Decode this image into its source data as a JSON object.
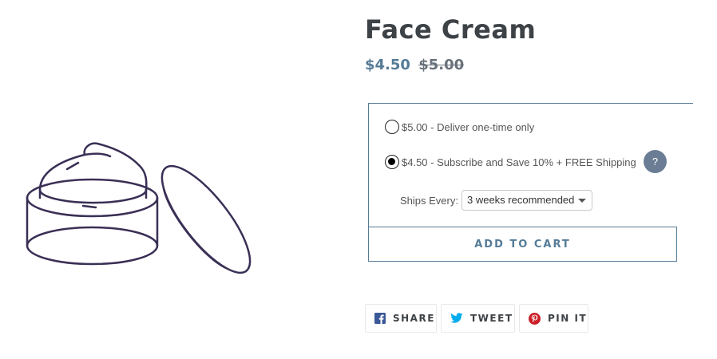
{
  "product": {
    "title": "Face Cream",
    "price_sale": "$4.50",
    "price_compare": "$5.00"
  },
  "purchase_options": [
    {
      "label": "$5.00 - Deliver one-time only",
      "selected": false
    },
    {
      "label": "$4.50 - Subscribe and Save 10% + FREE Shipping",
      "selected": true
    }
  ],
  "help": {
    "symbol": "?"
  },
  "ships_every": {
    "label": "Ships Every:",
    "selected_value": "3 weeks recommended"
  },
  "add_to_cart_label": "ADD TO CART",
  "social": {
    "share_label": "SHARE",
    "tweet_label": "TWEET",
    "pin_label": "PIN IT"
  },
  "icons": {
    "product_image": "cream-jar-illustration",
    "facebook": "facebook-icon",
    "twitter": "twitter-icon",
    "pinterest": "pinterest-icon"
  },
  "colors": {
    "accent": "#557b97",
    "text": "#3d4246",
    "help_badge": "#6a7d94",
    "facebook": "#3b5998",
    "twitter": "#00aced",
    "pinterest": "#cb2027",
    "illustration": "#3a2f55"
  }
}
